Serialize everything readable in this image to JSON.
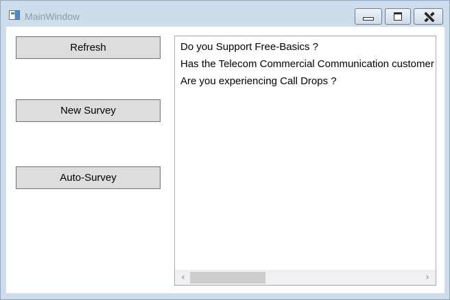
{
  "window": {
    "title": "MainWindow",
    "icons": {
      "app": "app-window-icon",
      "minimize": "minimize-icon",
      "maximize": "maximize-icon",
      "close": "close-icon"
    }
  },
  "buttons": {
    "refresh": "Refresh",
    "new_survey": "New Survey",
    "auto_survey": "Auto-Survey"
  },
  "list": {
    "items": [
      "Do you Support Free-Basics ?",
      "Has the Telecom Commercial Communication customer",
      "Are you experiencing Call Drops ?"
    ],
    "scrollbar": {
      "left_arrow": "‹",
      "right_arrow": "›"
    }
  },
  "colors": {
    "frame": "#cfdcec",
    "button_face": "#dddddd",
    "button_border": "#707070",
    "title_text": "#8c99a8"
  }
}
